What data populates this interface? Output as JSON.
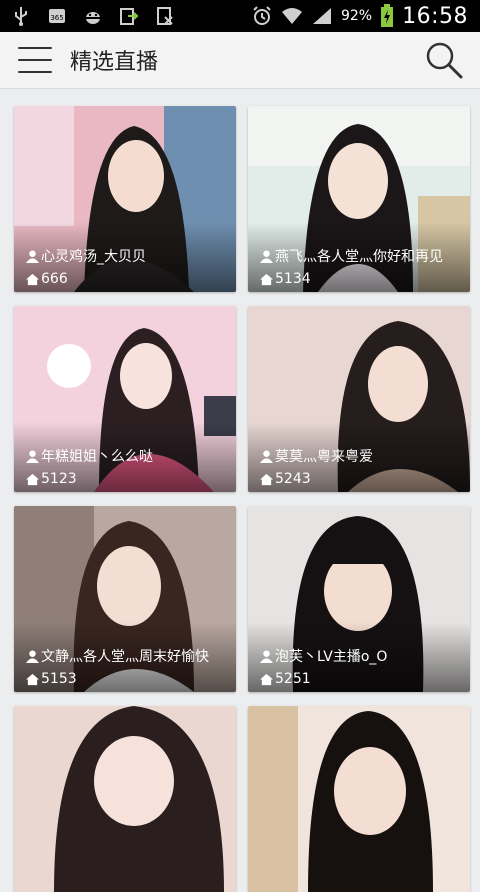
{
  "status_bar": {
    "battery_percent": "92%",
    "time": "16:58",
    "icons": [
      "usb-icon",
      "sim-365-icon",
      "android-debug-icon",
      "export-icon",
      "document-x-icon",
      "alarm-icon",
      "wifi-icon",
      "signal-icon",
      "battery-charging-icon"
    ]
  },
  "app_bar": {
    "title": "精选直播",
    "menu_icon": "hamburger-menu-icon",
    "search_icon": "search-icon"
  },
  "streams": [
    {
      "name": "心灵鸡汤_大贝贝",
      "viewers": "666"
    },
    {
      "name": "燕飞灬各人堂灬你好和再见",
      "viewers": "5134"
    },
    {
      "name": "年糕姐姐丶么么哒",
      "viewers": "5123"
    },
    {
      "name": "莫莫灬粤来粤爱",
      "viewers": "5243"
    },
    {
      "name": "文静灬各人堂灬周末好愉快",
      "viewers": "5153"
    },
    {
      "name": "泡芙丶LV主播o_O",
      "viewers": "5251"
    },
    {
      "name": "",
      "viewers": ""
    },
    {
      "name": "",
      "viewers": ""
    }
  ],
  "colors": {
    "status_bar_bg": "#000000",
    "app_bar_bg": "#f3f3f3",
    "page_bg": "#ecedef",
    "overlay_text": "#ffffff",
    "battery_accent": "#8dc63f"
  }
}
